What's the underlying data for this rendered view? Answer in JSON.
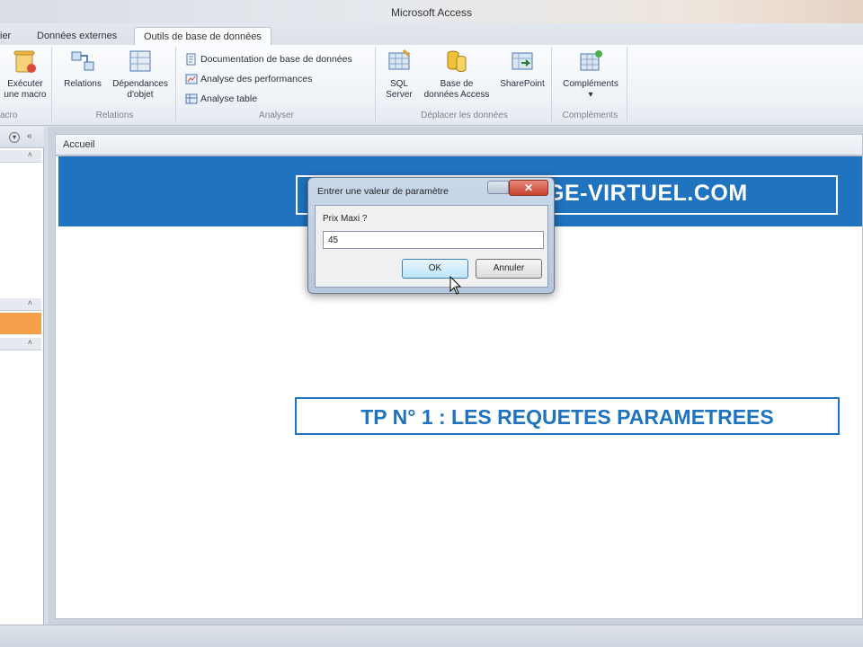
{
  "app": {
    "title": "Microsoft Access"
  },
  "tabs": {
    "items": [
      {
        "label": "ier"
      },
      {
        "label": "Données externes"
      },
      {
        "label": "Outils de base de données"
      }
    ]
  },
  "ribbon": {
    "macro": {
      "button_line1": "Exécuter",
      "button_line2": "une macro",
      "group_label": "acro"
    },
    "relations": {
      "relations_label": "Relations",
      "deps_line1": "Dépendances",
      "deps_line2": "d'objet",
      "group_label": "Relations"
    },
    "analyser": {
      "doc_label": "Documentation de base de données",
      "perf_label": "Analyse des performances",
      "table_label": "Analyse table",
      "group_label": "Analyser"
    },
    "move": {
      "sql_line1": "SQL",
      "sql_line2": "Server",
      "access_line1": "Base de",
      "access_line2": "données Access",
      "sharepoint_label": "SharePoint",
      "group_label": "Déplacer les données"
    },
    "addins": {
      "button_label": "Compléments",
      "group_label": "Compléments"
    }
  },
  "document": {
    "tab_label": "Accueil",
    "banner_text": "GE-VIRTUEL.COM",
    "tp_title": "TP N° 1 : LES REQUETES PARAMETREES"
  },
  "dialog": {
    "title": "Entrer une valeur de paramètre",
    "prompt": "Prix Maxi ?",
    "input_value": "45",
    "ok_label": "OK",
    "cancel_label": "Annuler"
  },
  "colors": {
    "banner": "#1f73bf",
    "nav_selected": "#f4a04a"
  }
}
